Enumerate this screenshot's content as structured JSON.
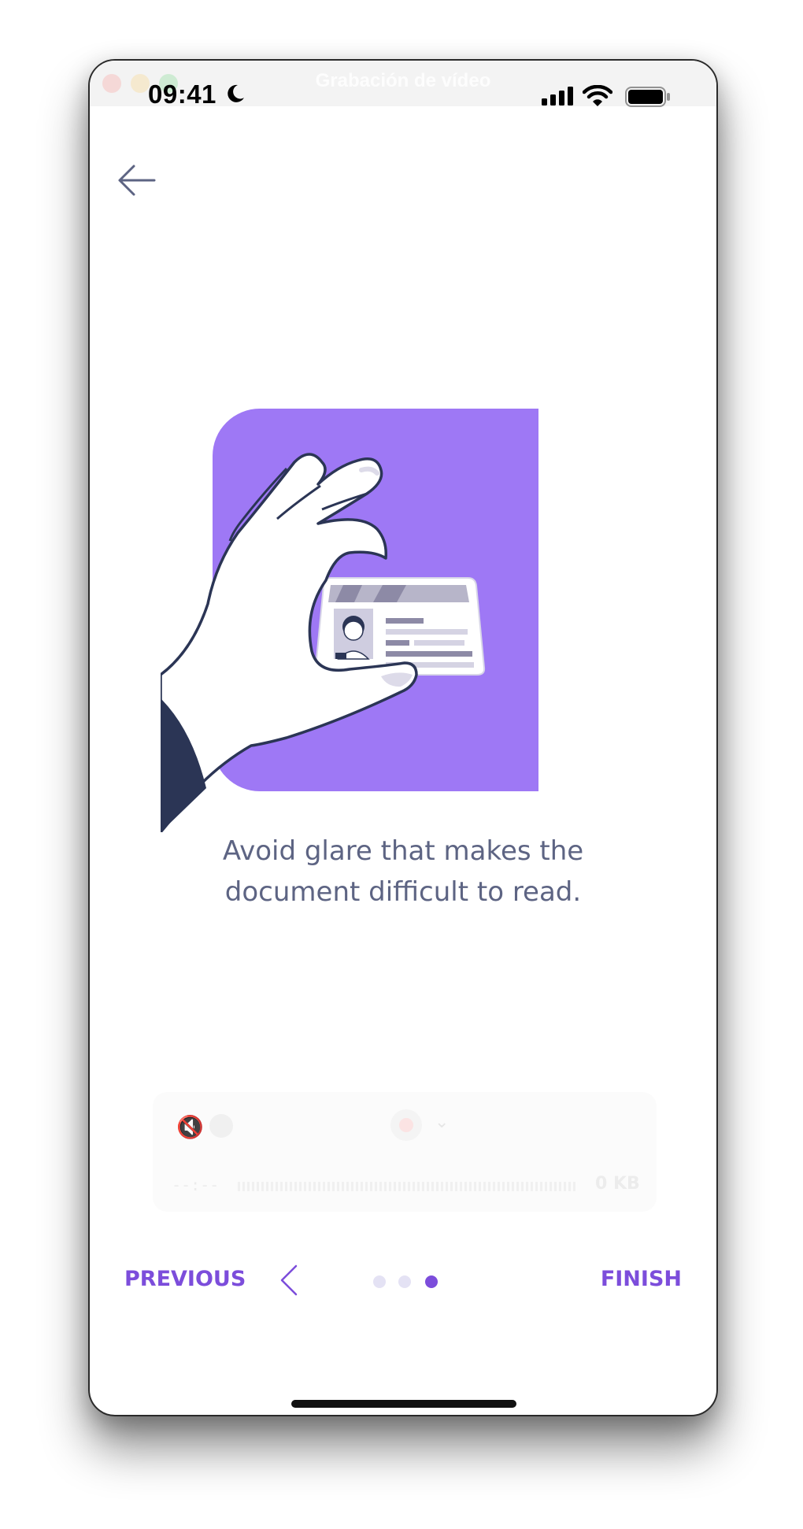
{
  "status_bar": {
    "time": "09:41",
    "recording_title": "Grabación de vídeo"
  },
  "onboarding": {
    "caption_line1": "Avoid glare that makes the",
    "caption_line2": "document difficult to read.",
    "current_step": 3,
    "total_steps": 3
  },
  "recorder_overlay": {
    "timer": "--:--",
    "size": "0 KB"
  },
  "navigation": {
    "previous_label": "PREVIOUS",
    "finish_label": "FINISH"
  },
  "icons": {
    "back": "arrow-left-icon",
    "previous": "chevron-left-icon",
    "moon": "moon-icon",
    "signal": "cellular-signal-icon",
    "wifi": "wifi-icon",
    "battery": "battery-icon"
  },
  "colors": {
    "accent": "#7c4ddb",
    "illustration_bg": "#9e78f5",
    "navy": "#2b3555",
    "caption_text": "#5d6483",
    "dot_inactive": "#e4e2f4"
  }
}
